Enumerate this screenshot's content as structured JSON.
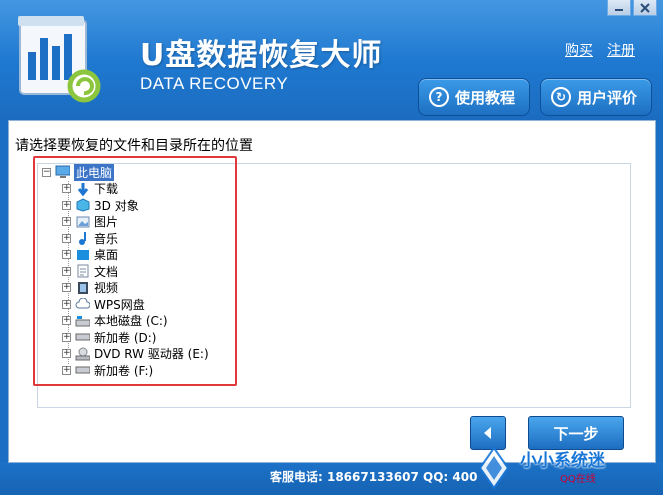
{
  "app": {
    "title": "U盘数据恢复大师",
    "subtitle": "DATA RECOVERY"
  },
  "top_links": {
    "buy": "购买",
    "register": "注册"
  },
  "header_buttons": {
    "tutorial": "使用教程",
    "review": "用户评价"
  },
  "panel": {
    "prompt": "请选择要恢复的文件和目录所在的位置"
  },
  "tree": {
    "root": "此电脑",
    "children": [
      {
        "label": "下载",
        "icon": "download-arrow-icon"
      },
      {
        "label": "3D 对象",
        "icon": "3d-cube-icon"
      },
      {
        "label": "图片",
        "icon": "picture-icon"
      },
      {
        "label": "音乐",
        "icon": "music-note-icon"
      },
      {
        "label": "桌面",
        "icon": "desktop-icon"
      },
      {
        "label": "文档",
        "icon": "document-icon"
      },
      {
        "label": "视频",
        "icon": "video-icon"
      },
      {
        "label": "WPS网盘",
        "icon": "cloud-icon"
      },
      {
        "label": "本地磁盘 (C:)",
        "icon": "system-drive-icon"
      },
      {
        "label": "新加卷 (D:)",
        "icon": "drive-icon"
      },
      {
        "label": "DVD RW 驱动器 (E:)",
        "icon": "dvd-drive-icon"
      },
      {
        "label": "新加卷 (F:)",
        "icon": "drive-icon"
      }
    ]
  },
  "buttons": {
    "next": "下一步"
  },
  "footer": {
    "contact": "客服电话: 18667133607 QQ: 400"
  },
  "watermark": {
    "text": "小小系统迷",
    "sub": "QQ在线"
  },
  "colors": {
    "header_blue": "#1f78cf",
    "highlight_red": "#e0393c",
    "selected_blue": "#3c74c8"
  }
}
